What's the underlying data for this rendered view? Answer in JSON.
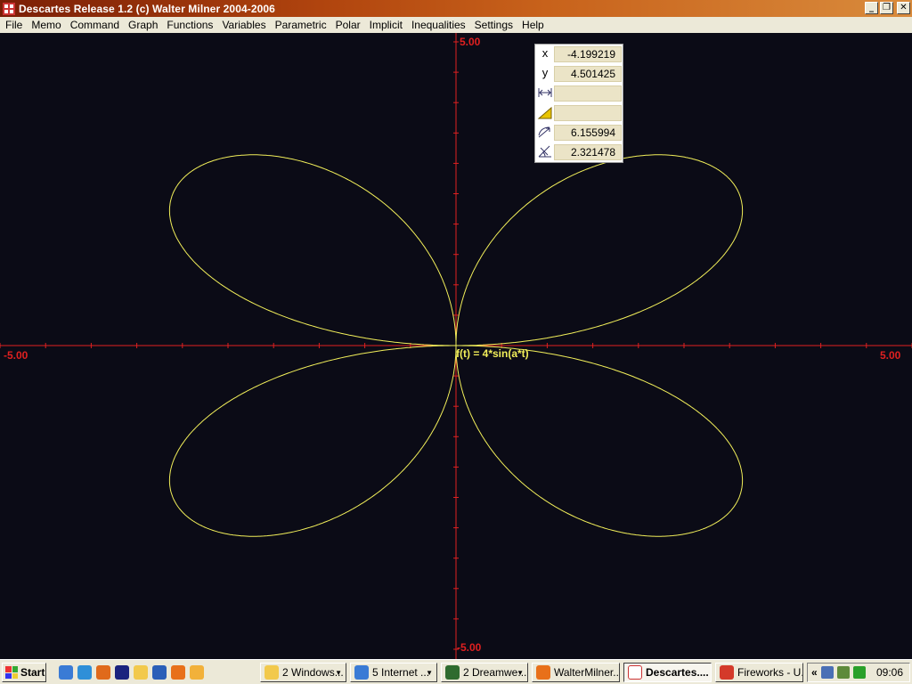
{
  "window": {
    "title": "Descartes Release 1.2 (c) Walter Milner 2004-2006",
    "controls": [
      "_",
      "❐",
      "✕"
    ]
  },
  "menu": [
    "File",
    "Memo",
    "Command",
    "Graph",
    "Functions",
    "Variables",
    "Parametric",
    "Polar",
    "Implicit",
    "Inequalities",
    "Settings",
    "Help"
  ],
  "graph": {
    "axis_labels": {
      "top": "5.00",
      "bottom": "-5.00",
      "left": "-5.00",
      "right": "5.00"
    },
    "function_label": "f(t) = 4*sin(a*t)",
    "axis_color": "#e02020",
    "curve_color": "#f2ef5a"
  },
  "info_panel": {
    "x_label": "x",
    "x_value": "-4.199219",
    "y_label": "y",
    "y_value": "4.501425",
    "distance_value": "",
    "gradient_value": "",
    "radius_value": "6.155994",
    "angle_value": "2.321478"
  },
  "taskbar": {
    "start_label": "Start",
    "tasks": [
      "2 Windows...",
      "5 Internet ...",
      "2 Dreamwe...",
      "WalterMilner....",
      "Descartes....",
      "Fireworks - U..."
    ],
    "tray_chevron": "«",
    "clock": "09:06"
  }
}
